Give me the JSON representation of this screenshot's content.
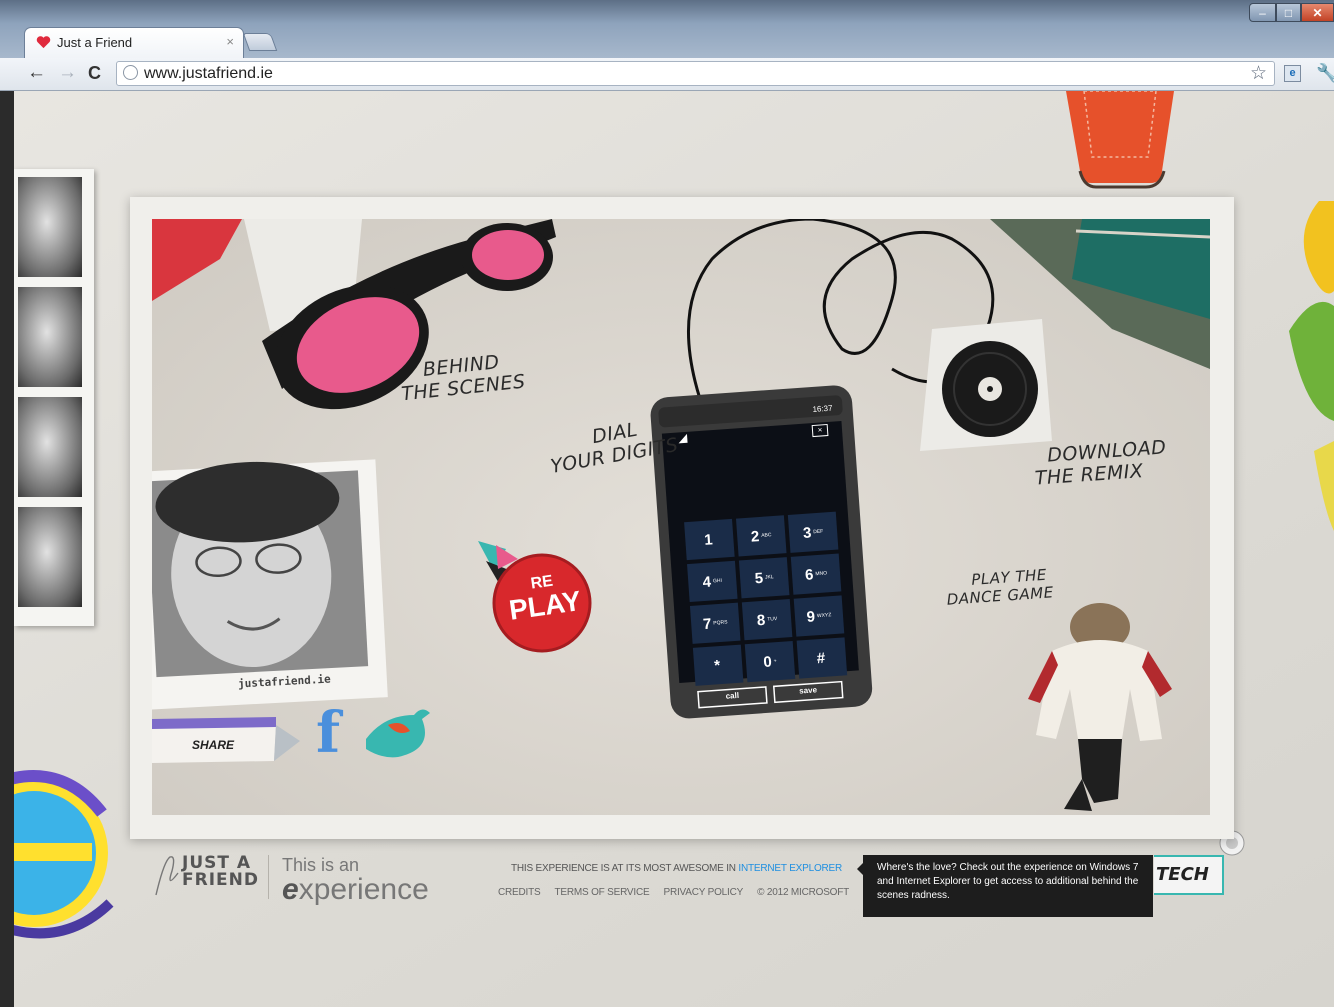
{
  "browser": {
    "tab_title": "Just a Friend",
    "tab_close": "×",
    "url": "www.justafriend.ie",
    "window_buttons": {
      "minimize": "–",
      "maximize": "□",
      "close": "✕"
    },
    "nav": {
      "back": "←",
      "forward": "→",
      "reload": "C"
    },
    "star": "☆",
    "ie_extension": "e",
    "wrench": "🔧"
  },
  "scene": {
    "behind_scenes": [
      "BEHIND",
      "THE SCENES"
    ],
    "dial": [
      "DIAL",
      "YOUR DIGITS"
    ],
    "download": [
      "DOWNLOAD",
      "THE REMIX"
    ],
    "dance": [
      "PLAY THE",
      "DANCE GAME"
    ],
    "replay": {
      "top": "RE",
      "bottom": "PLAY"
    },
    "polaroid_caption": "justafriend.ie",
    "share": "SHARE",
    "facebook": "f"
  },
  "phone": {
    "time": "16:37",
    "keys": [
      {
        "digit": "1",
        "sub": ""
      },
      {
        "digit": "2",
        "sub": "ABC"
      },
      {
        "digit": "3",
        "sub": "DEF"
      },
      {
        "digit": "4",
        "sub": "GHI"
      },
      {
        "digit": "5",
        "sub": "JKL"
      },
      {
        "digit": "6",
        "sub": "MNO"
      },
      {
        "digit": "7",
        "sub": "PQRS"
      },
      {
        "digit": "8",
        "sub": "TUV"
      },
      {
        "digit": "9",
        "sub": "WXYZ"
      },
      {
        "digit": "*",
        "sub": ""
      },
      {
        "digit": "0",
        "sub": "+"
      },
      {
        "digit": "#",
        "sub": ""
      }
    ],
    "call": "call",
    "save": "save"
  },
  "footer": {
    "logo": [
      "JUST A",
      "FRIEND"
    ],
    "this_is_an": "This is an",
    "experience_e": "e",
    "experience_rest": "xperience",
    "line1_prefix": "THIS EXPERIENCE IS AT ITS MOST AWESOME IN ",
    "line1_link": "INTERNET EXPLORER",
    "links": [
      "CREDITS",
      "TERMS OF SERVICE",
      "PRIVACY POLICY",
      "© 2012 MICROSOFT"
    ],
    "tooltip": "Where's the love? Check out the experience on Windows 7 and Internet Explorer to get access to additional behind the scenes radness.",
    "tech": "TECH"
  },
  "colors": {
    "accent_pink": "#e85a8c",
    "replay_red": "#d8282c",
    "ie_blue": "#1f8fe0",
    "tech_teal": "#38b7b0"
  }
}
